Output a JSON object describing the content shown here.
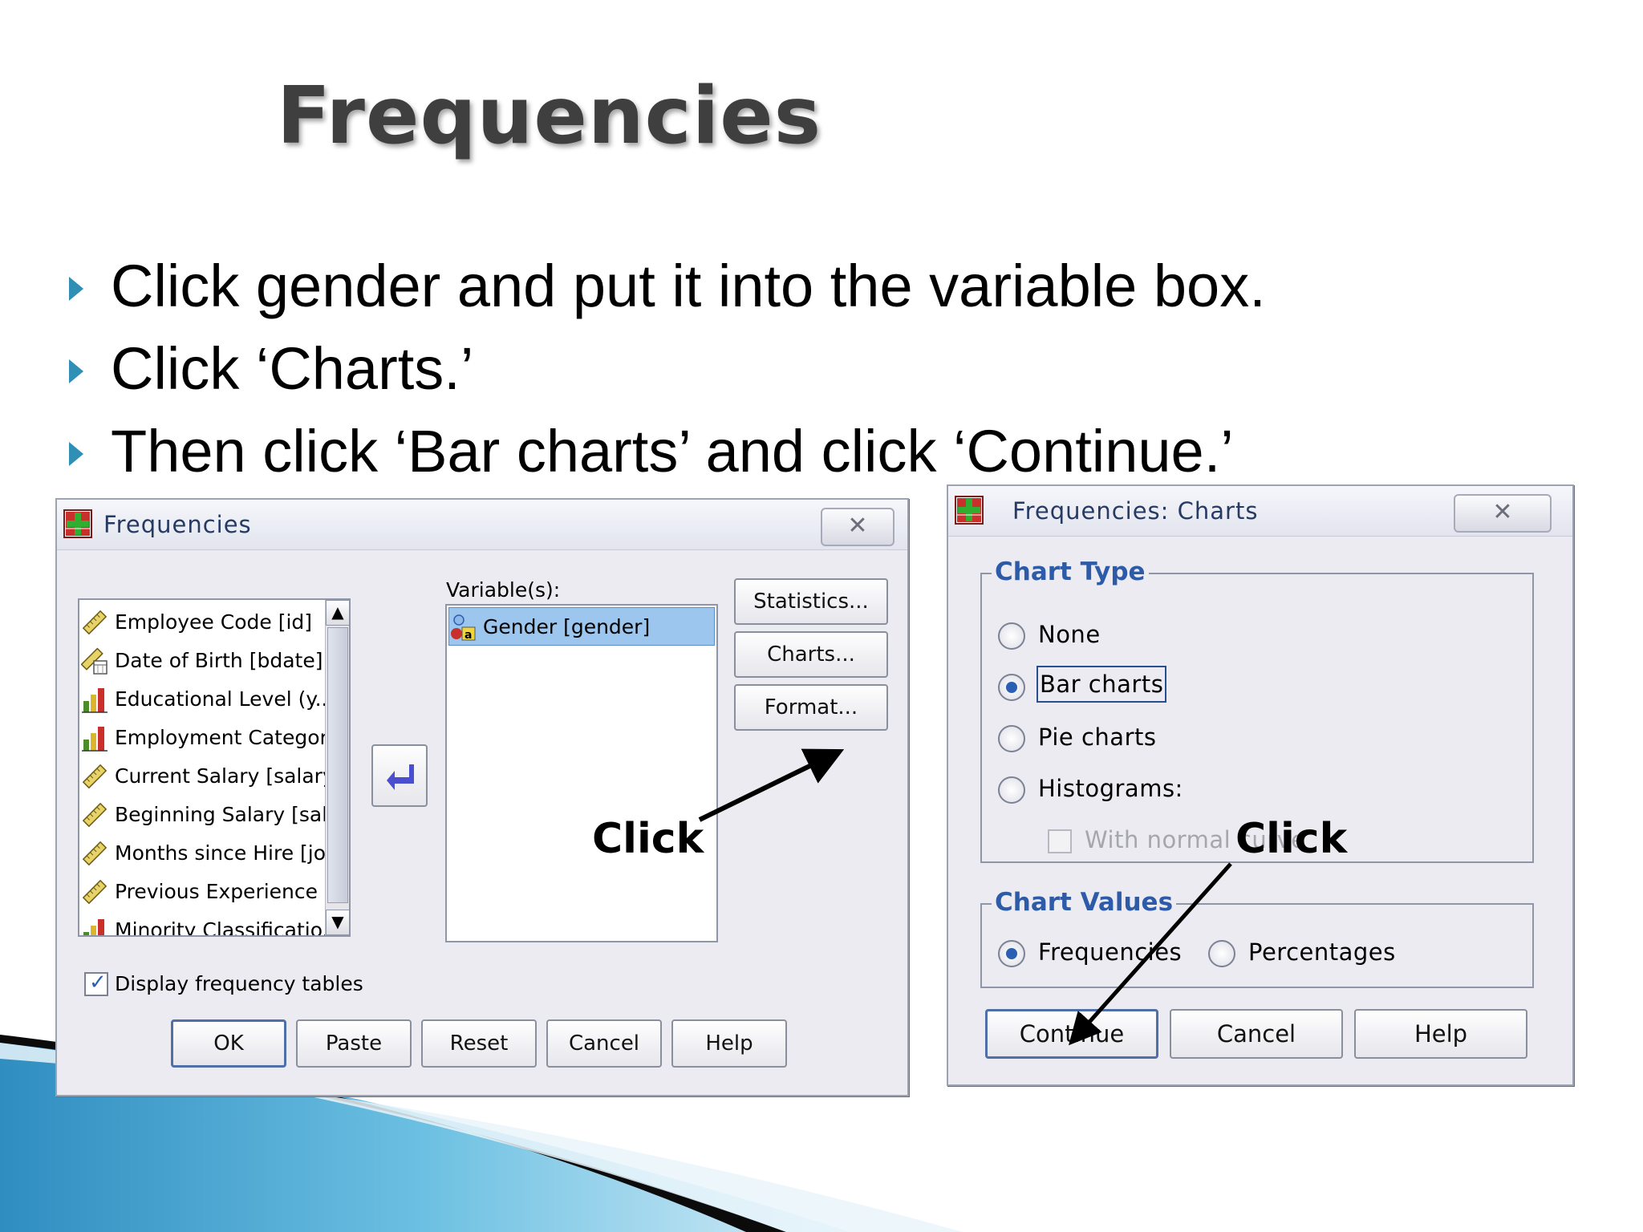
{
  "slide": {
    "title": "Frequencies",
    "bullets": [
      "Click gender and put it into the variable box.",
      "Click ‘Charts.’",
      "Then click ‘Bar charts’ and click ‘Continue.’"
    ]
  },
  "frequencies_dialog": {
    "title": "Frequencies",
    "close_label": "✕",
    "source_variables": [
      {
        "label": "Employee Code [id]",
        "icon": "ruler-icon"
      },
      {
        "label": "Date of Birth [bdate]",
        "icon": "calendar-ruler-icon"
      },
      {
        "label": "Educational Level (y...",
        "icon": "bar-chart-icon"
      },
      {
        "label": "Employment Categor...",
        "icon": "bar-chart-icon"
      },
      {
        "label": "Current Salary [salary]",
        "icon": "ruler-icon"
      },
      {
        "label": "Beginning Salary [sal...",
        "icon": "ruler-icon"
      },
      {
        "label": "Months since Hire [jo...",
        "icon": "ruler-icon"
      },
      {
        "label": "Previous Experience ...",
        "icon": "ruler-icon"
      },
      {
        "label": "Minority Classificatio...",
        "icon": "bar-chart-icon"
      }
    ],
    "variables_label": "Variable(s):",
    "selected_variables": [
      {
        "label": "Gender [gender]",
        "icon": "nominal-string-icon"
      }
    ],
    "side_buttons": {
      "statistics": "Statistics...",
      "charts": "Charts...",
      "format": "Format..."
    },
    "display_tables_label": "Display frequency tables",
    "display_tables_checked": true,
    "bottom_buttons": {
      "ok": "OK",
      "paste": "Paste",
      "reset": "Reset",
      "cancel": "Cancel",
      "help": "Help"
    }
  },
  "charts_dialog": {
    "title": "Frequencies: Charts",
    "close_label": "✕",
    "chart_type": {
      "title": "Chart Type",
      "options": {
        "none": "None",
        "bar": "Bar charts",
        "pie": "Pie charts",
        "histograms": "Histograms:"
      },
      "selected": "bar",
      "normal_curve_label": "With normal curve"
    },
    "chart_values": {
      "title": "Chart Values",
      "options": {
        "frequencies": "Frequencies",
        "percentages": "Percentages"
      },
      "selected": "frequencies"
    },
    "buttons": {
      "continue": "Continue",
      "cancel": "Cancel",
      "help": "Help"
    }
  },
  "annotations": {
    "click_left": "Click",
    "click_right": "Click"
  },
  "colors": {
    "accent_blue": "#2e5ba8",
    "bullet_triangle": "#2f8fb5",
    "selection_highlight": "#9cc6ee",
    "swoosh_dark": "#0b0b0b",
    "swoosh_blue": "#4aa8d1"
  }
}
